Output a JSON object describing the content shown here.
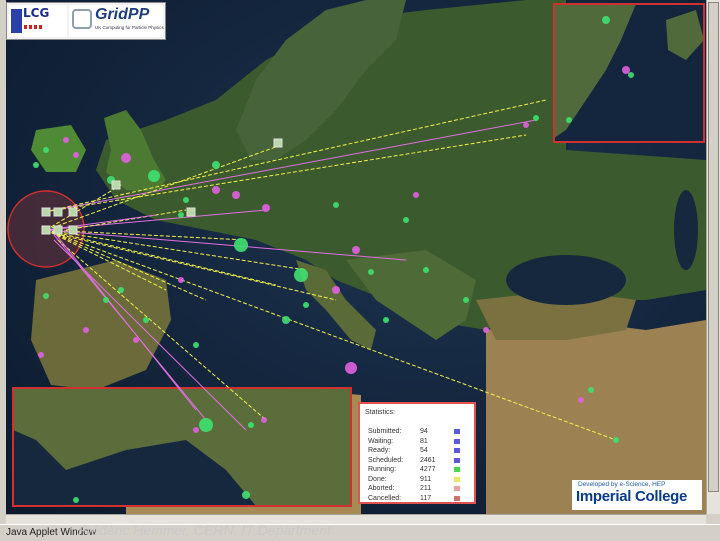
{
  "logos": {
    "lcg": "LCG",
    "gridpp": "GridPP",
    "gridpp_tagline": "UK Computing for Particle Physics"
  },
  "statistics": {
    "title": "Statistics:",
    "rows": [
      {
        "label": "Submitted:",
        "value": "94",
        "color": "#5a5ad8"
      },
      {
        "label": "Waiting:",
        "value": "81",
        "color": "#5a5ad8"
      },
      {
        "label": "Ready:",
        "value": "54",
        "color": "#5a5ad8"
      },
      {
        "label": "Scheduled:",
        "value": "2461",
        "color": "#5a5ad8"
      },
      {
        "label": "Running:",
        "value": "4277",
        "color": "#48d848"
      },
      {
        "label": "Done:",
        "value": "911",
        "color": "#e8e860"
      },
      {
        "label": "Aborted:",
        "value": "211",
        "color": "#e8a0a0"
      },
      {
        "label": "Cancelled:",
        "value": "117",
        "color": "#d07070"
      }
    ]
  },
  "branding": {
    "developed_by": "Developed by e-Science, HEP",
    "institution": "Imperial College"
  },
  "status_bar": {
    "text": "Java Applet Window",
    "credit": "Frédéric Hemmer, CERN, IT Department"
  },
  "colors": {
    "job_line_yellow": "#f2f24a",
    "job_line_pink": "#e070e0",
    "site_green": "#3fe070",
    "site_magenta": "#e060e0",
    "highlight_border": "#d03030"
  }
}
